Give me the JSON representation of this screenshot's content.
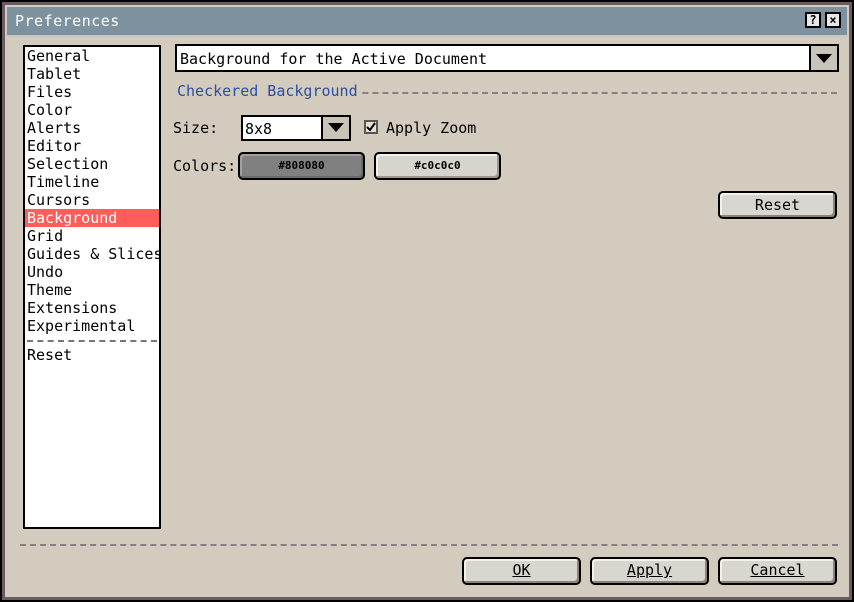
{
  "window": {
    "title": "Preferences",
    "help_label": "?",
    "close_label": "×"
  },
  "sidebar": {
    "items": [
      {
        "label": "General"
      },
      {
        "label": "Tablet"
      },
      {
        "label": "Files"
      },
      {
        "label": "Color"
      },
      {
        "label": "Alerts"
      },
      {
        "label": "Editor"
      },
      {
        "label": "Selection"
      },
      {
        "label": "Timeline"
      },
      {
        "label": "Cursors"
      },
      {
        "label": "Background",
        "selected": true
      },
      {
        "label": "Grid"
      },
      {
        "label": "Guides & Slices"
      },
      {
        "label": "Undo"
      },
      {
        "label": "Theme"
      },
      {
        "label": "Extensions"
      },
      {
        "label": "Experimental"
      }
    ],
    "reset_label": "Reset"
  },
  "main": {
    "target_dropdown": {
      "value": "Background for the Active Document"
    },
    "section_title": "Checkered Background",
    "size_label": "Size:",
    "size_value": "8x8",
    "apply_zoom_label": "Apply Zoom",
    "apply_zoom_checked": true,
    "colors_label": "Colors:",
    "color1": "#808080",
    "color2": "#c0c0c0",
    "reset_label": "Reset"
  },
  "footer": {
    "ok_label": "OK",
    "apply_label": "Apply",
    "cancel_label": "Cancel"
  },
  "colors": {
    "selection_bg": "#ff5c5c",
    "titlebar_bg": "#7d929e",
    "section_title": "#2b4ea0",
    "dialog_bg": "#d3cbbe"
  }
}
